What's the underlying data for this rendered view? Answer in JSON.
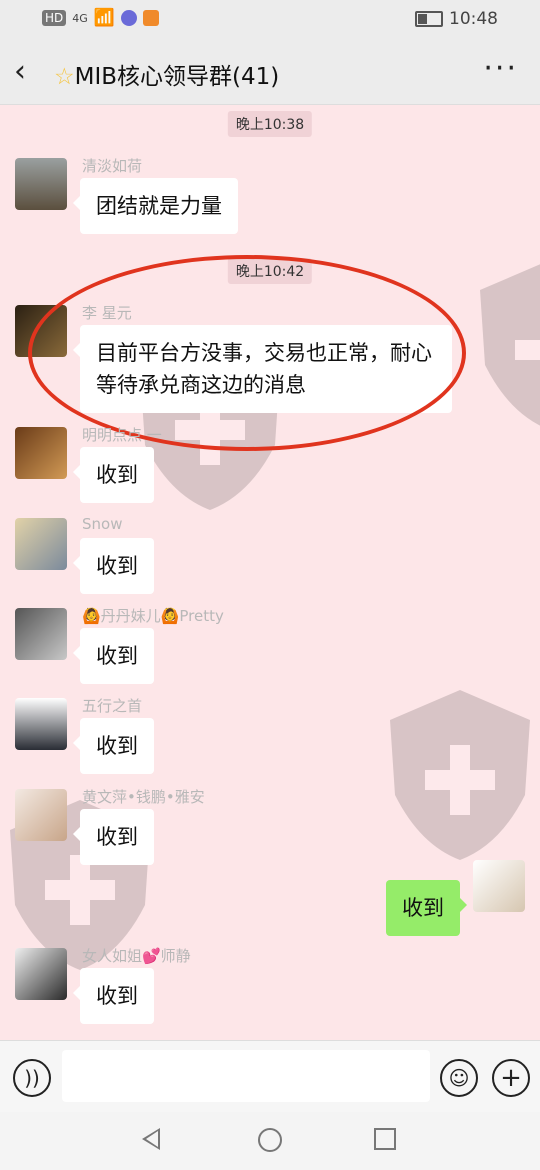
{
  "status": {
    "time": "10:48",
    "net": "4G",
    "hd": "HD"
  },
  "header": {
    "title_icon": "star-icon",
    "title": "MIB核心领导群(41)",
    "back": "‹",
    "more": "···"
  },
  "messages": [
    {
      "time": "晚上10:38"
    },
    {
      "sender": "清淡如荷",
      "text": "团结就是力量"
    },
    {
      "time": "晚上10:42"
    },
    {
      "sender": "李 星元",
      "text": "目前平台方没事，交易也正常，耐心等待承兑商这边的消息"
    },
    {
      "sender": "明明点点 一",
      "text": "收到"
    },
    {
      "sender": "Snow",
      "text": "收到"
    },
    {
      "sender": "🙆丹丹妹儿🙆Pretty",
      "text": "收到"
    },
    {
      "sender": "五行之首",
      "text": "收到"
    },
    {
      "sender": "黄文萍•钱鹏•雅安",
      "text": "收到"
    },
    {
      "mine": true,
      "text": "收到"
    },
    {
      "sender": "女人如姐💕师静",
      "text": "收到"
    }
  ],
  "input": {
    "placeholder": ""
  },
  "colors": {
    "bubble_mine": "#95ec69",
    "annotation": "#e0341e",
    "chat_bg": "#fde6e8"
  }
}
